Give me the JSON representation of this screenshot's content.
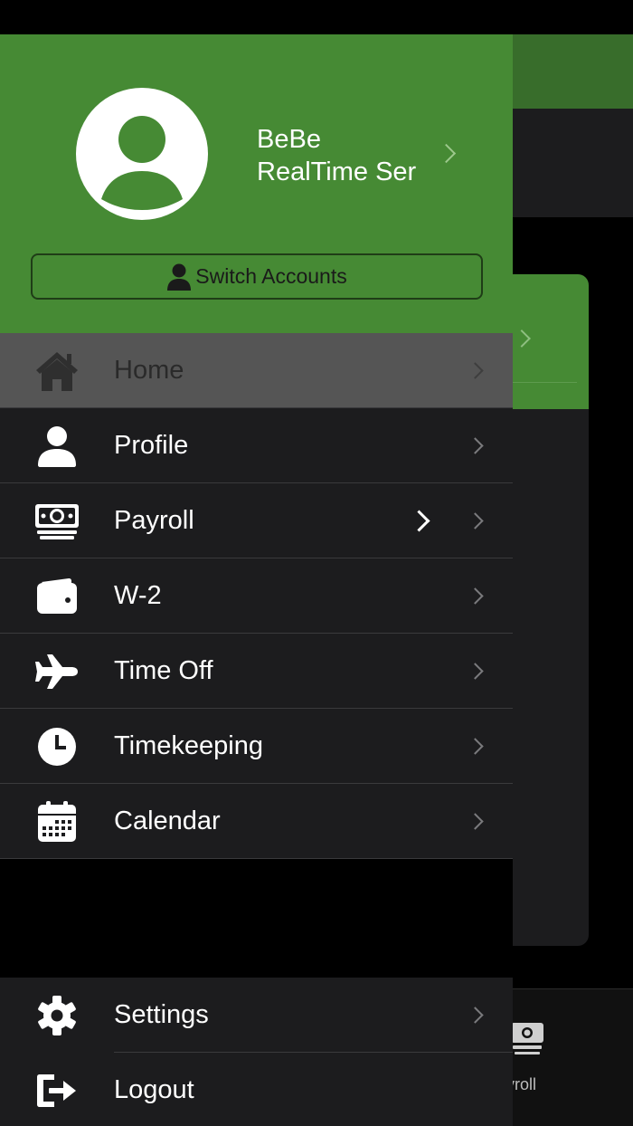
{
  "user": {
    "name": "BeBe",
    "company": "RealTime Ser"
  },
  "switch_accounts_label": "Switch Accounts",
  "menu": {
    "home": "Home",
    "profile": "Profile",
    "payroll": "Payroll",
    "w2": "W-2",
    "time_off": "Time Off",
    "timekeeping": "Timekeeping",
    "calendar": "Calendar"
  },
  "bottom_menu": {
    "settings": "Settings",
    "logout": "Logout"
  },
  "background": {
    "tab_label": "yroll"
  },
  "colors": {
    "brand_green": "#468a34",
    "dark_green": "#386d2b",
    "surface": "#1c1c1e",
    "active_row": "#555555"
  },
  "icons": {
    "home": "house-icon",
    "profile": "person-icon",
    "payroll": "money-bill-icon",
    "w2": "wallet-icon",
    "time_off": "airplane-icon",
    "timekeeping": "clock-icon",
    "calendar": "calendar-icon",
    "settings": "gear-icon",
    "logout": "sign-out-icon"
  }
}
